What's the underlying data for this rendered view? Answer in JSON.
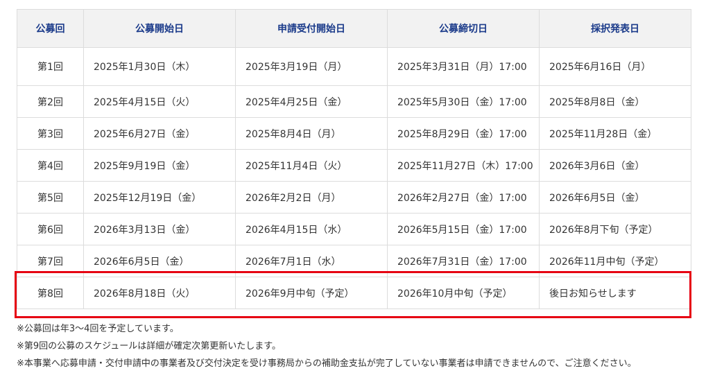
{
  "table": {
    "headers": [
      "公募回",
      "公募開始日",
      "申請受付開始日",
      "公募締切日",
      "採択発表日"
    ],
    "rows": [
      [
        "第1回",
        "2025年1月30日（木）",
        "2025年3月19日（月）",
        "2025年3月31日（月）17:00",
        "2025年6月16日（月）"
      ],
      [
        "第2回",
        "2025年4月15日（火）",
        "2025年4月25日（金）",
        "2025年5月30日（金）17:00",
        "2025年8月8日（金）"
      ],
      [
        "第3回",
        "2025年6月27日（金）",
        "2025年8月4日（月）",
        "2025年8月29日（金）17:00",
        "2025年11月28日（金）"
      ],
      [
        "第4回",
        "2025年9月19日（金）",
        "2025年11月4日（火）",
        "2025年11月27日（木）17:00",
        "2026年3月6日（金）"
      ],
      [
        "第5回",
        "2025年12月19日（金）",
        "2026年2月2日（月）",
        "2026年2月27日（金）17:00",
        "2026年6月5日（金）"
      ],
      [
        "第6回",
        "2026年3月13日（金）",
        "2026年4月15日（水）",
        "2026年5月15日（金）17:00",
        "2026年8月下旬（予定）"
      ],
      [
        "第7回",
        "2026年6月5日（金）",
        "2026年7月1日（水）",
        "2026年7月31日（金）17:00",
        "2026年11月中旬（予定）"
      ],
      [
        "第8回",
        "2026年8月18日（火）",
        "2026年9月中旬（予定）",
        "2026年10月中旬（予定）",
        "後日お知らせします"
      ]
    ]
  },
  "notes": [
    "※公募回は年3〜4回を予定しています。",
    "※第9回の公募のスケジュールは詳細が確定次第更新いたします。",
    "※本事業へ応募申請・交付申請中の事業者及び交付決定を受け事務局からの補助金支払が完了していない事業者は申請できませんので、ご注意ください。"
  ],
  "colors": {
    "header_text": "#1a3a8a",
    "header_bg": "#f2f2f2",
    "highlight_border": "#e60012"
  }
}
